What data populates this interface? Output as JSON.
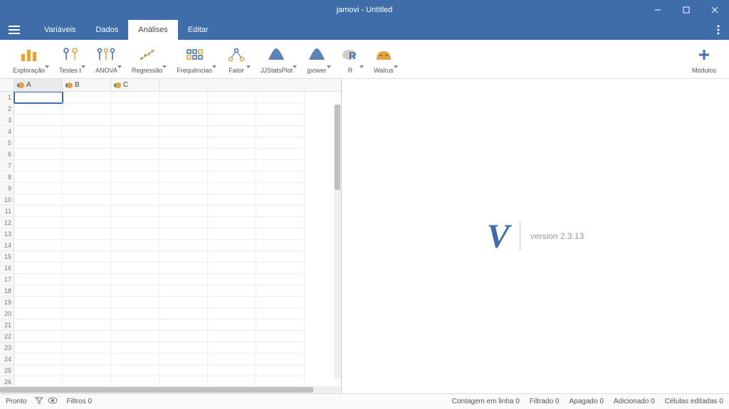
{
  "title": "jamovi - Untitled",
  "menu": {
    "tabs": [
      "Variáveis",
      "Dados",
      "Análises",
      "Editar"
    ],
    "active": 2
  },
  "toolbar": [
    {
      "id": "exploracao",
      "label": "Exploração",
      "icon": "bars",
      "caret": true
    },
    {
      "id": "testes-t",
      "label": "Testes t",
      "icon": "ttest",
      "caret": true
    },
    {
      "id": "anova",
      "label": "ANOVA",
      "icon": "anova",
      "caret": true
    },
    {
      "id": "regressao",
      "label": "Regressão",
      "icon": "regression",
      "caret": true
    },
    {
      "id": "frequencias",
      "label": "Frequências",
      "icon": "freq",
      "caret": true
    },
    {
      "id": "fator",
      "label": "Fator",
      "icon": "factor",
      "caret": true
    },
    {
      "id": "jjstatsplot",
      "label": "JJStatsPlot",
      "icon": "density",
      "caret": true
    },
    {
      "id": "jpower",
      "label": "jpower",
      "icon": "density",
      "caret": true
    },
    {
      "id": "r",
      "label": "R",
      "icon": "r",
      "caret": true
    },
    {
      "id": "walrus",
      "label": "Walrus",
      "icon": "walrus",
      "caret": true
    }
  ],
  "modules_label": "Módulos",
  "columns": [
    "A",
    "B",
    "C"
  ],
  "version_label": "version 2.3.13",
  "status": {
    "ready": "Pronto",
    "filters": "Filtros 0",
    "row_count": "Contagem em linha 0",
    "filtered": "Filtrado 0",
    "deleted": "Apagado 0",
    "added": "Adicionado 0",
    "cells_edited": "Células editadas 0"
  }
}
